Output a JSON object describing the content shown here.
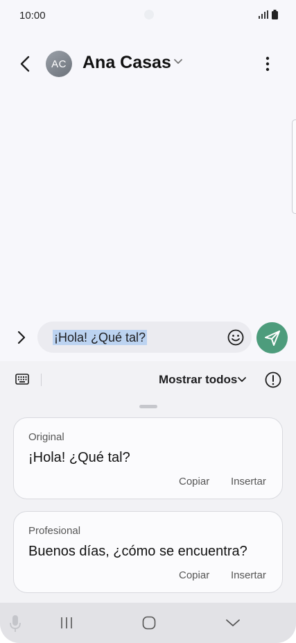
{
  "status_bar": {
    "time": "10:00"
  },
  "header": {
    "avatar_initials": "AC",
    "contact_name": "Ana Casas"
  },
  "compose": {
    "message": "¡Hola! ¿Qué tal?"
  },
  "panel": {
    "show_all_label": "Mostrar todos",
    "cards": [
      {
        "label": "Original",
        "text": "¡Hola! ¿Qué tal?",
        "copy": "Copiar",
        "insert": "Insertar"
      },
      {
        "label": "Profesional",
        "text": "Buenos días, ¿cómo se encuentra?",
        "copy": "Copiar",
        "insert": "Insertar"
      }
    ]
  },
  "icons": [
    "back-icon",
    "chevron-down-icon",
    "more-icon",
    "expand-icon",
    "emoji-icon",
    "send-icon",
    "keyboard-icon",
    "info-icon",
    "mic-icon",
    "recents-icon",
    "home-icon",
    "back-nav-icon"
  ],
  "colors": {
    "send_button": "#4d9c7c",
    "selection_highlight": "#bcd3f1",
    "background": "#f7f7fb"
  }
}
